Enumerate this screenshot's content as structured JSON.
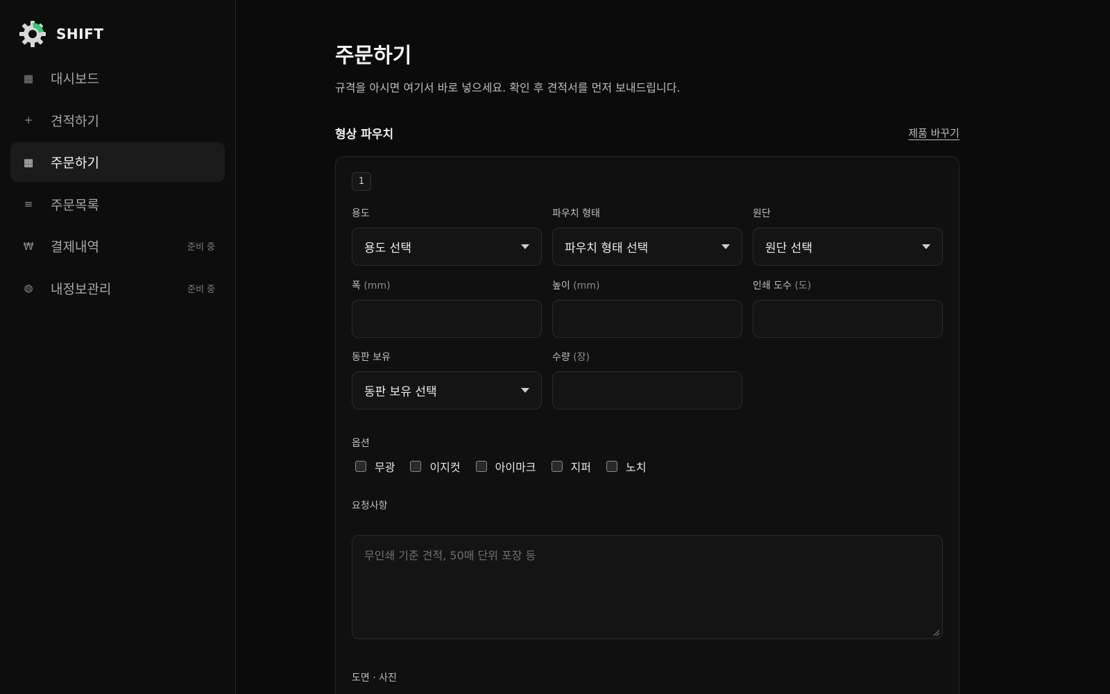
{
  "brand": {
    "name": "SHIFT",
    "accent": "#2ecc71"
  },
  "sidebar": {
    "items": [
      {
        "label": "대시보드",
        "icon": "dashboard-icon",
        "glyph": "▦",
        "badge": ""
      },
      {
        "label": "견적하기",
        "icon": "plus-icon",
        "glyph": "+",
        "badge": ""
      },
      {
        "label": "주문하기",
        "icon": "order-icon",
        "glyph": "▦",
        "badge": "",
        "active": true
      },
      {
        "label": "주문목록",
        "icon": "list-icon",
        "glyph": "≡",
        "badge": ""
      },
      {
        "label": "결제내역",
        "icon": "won-icon",
        "glyph": "₩",
        "badge": "준비 중"
      },
      {
        "label": "내정보관리",
        "icon": "profile-icon",
        "glyph": "◍",
        "badge": "준비 중"
      }
    ]
  },
  "page": {
    "title": "주문하기",
    "subtitle": "규격을 아시면 여기서 바로 넣으세요. 확인 후 견적서를 먼저 보내드립니다."
  },
  "product": {
    "title": "형상 파우치",
    "change_label": "제품 바꾸기",
    "item_number": "1"
  },
  "form": {
    "usage": {
      "label": "용도",
      "value": "용도 선택"
    },
    "pouch_type": {
      "label": "파우치 형태",
      "value": "파우치 형태 선택"
    },
    "fabric": {
      "label": "원단",
      "value": "원단 선택"
    },
    "width": {
      "label": "폭",
      "unit": "(mm)",
      "value": ""
    },
    "height": {
      "label": "높이",
      "unit": "(mm)",
      "value": ""
    },
    "print_colors": {
      "label": "인쇄 도수",
      "unit": "(도)",
      "value": ""
    },
    "plate": {
      "label": "동판 보유",
      "value": "동판 보유 선택"
    },
    "quantity": {
      "label": "수량",
      "unit": "(장)",
      "value": ""
    },
    "options_label": "옵션",
    "options": [
      "무광",
      "이지컷",
      "아이마크",
      "지퍼",
      "노치"
    ],
    "request_label": "요청사항",
    "request_placeholder": "무인쇄 기준 견적, 50매 단위 포장 등",
    "drawing_label": "도면 · 사진"
  }
}
